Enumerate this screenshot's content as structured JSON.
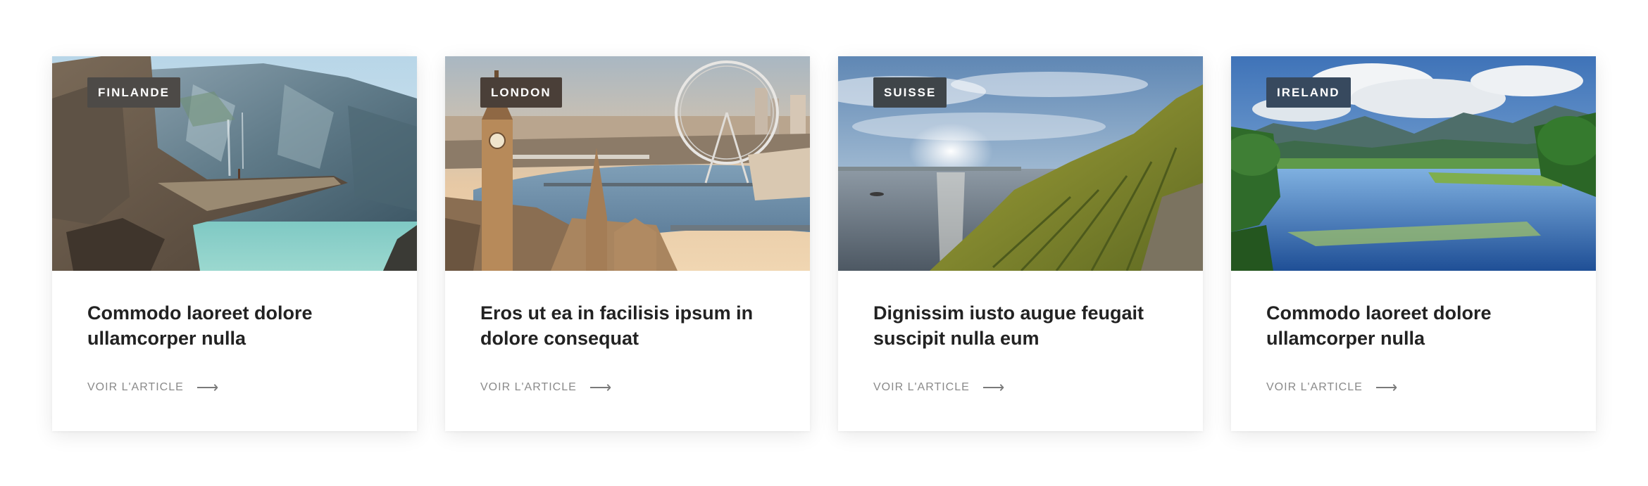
{
  "cards": [
    {
      "badge": "FINLANDE",
      "badge_color": "#4d4a47",
      "title": "Commodo laoreet dolore ullamcorper nulla",
      "link_label": "VOIR L'ARTICLE",
      "arrow_icon": "arrow-right-icon"
    },
    {
      "badge": "LONDON",
      "badge_color": "#4a3f38",
      "title": "Eros ut ea in facilisis ipsum in dolore consequat",
      "link_label": "VOIR L'ARTICLE",
      "arrow_icon": "arrow-right-icon"
    },
    {
      "badge": "SUISSE",
      "badge_color": "#3f4549",
      "title": "Dignissim iusto augue feugait suscipit nulla eum",
      "link_label": "VOIR L'ARTICLE",
      "arrow_icon": "arrow-right-icon"
    },
    {
      "badge": "IRELAND",
      "badge_color": "#37495e",
      "title": "Commodo laoreet dolore ullamcorper nulla",
      "link_label": "VOIR L'ARTICLE",
      "arrow_icon": "arrow-right-icon"
    }
  ]
}
